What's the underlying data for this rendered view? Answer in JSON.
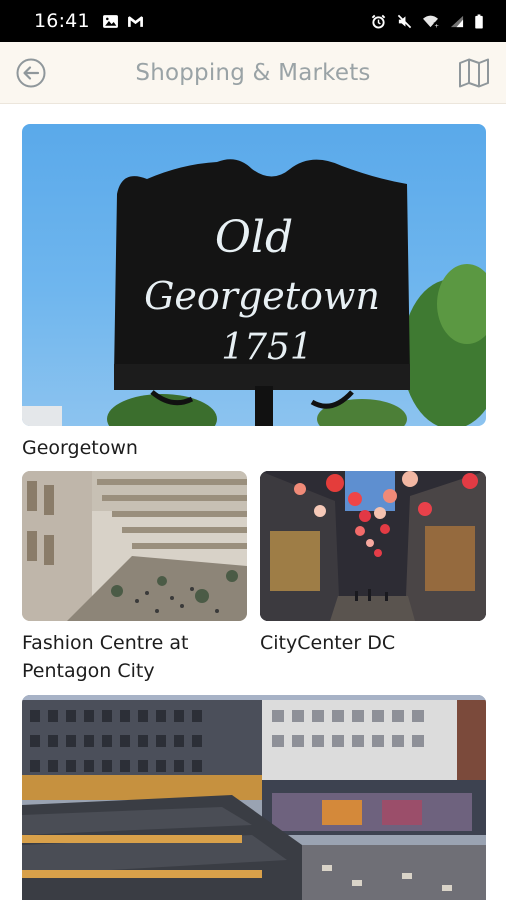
{
  "status_bar": {
    "time": "16:41",
    "left_icons": [
      "image-icon",
      "gmail-icon"
    ],
    "right_icons": [
      "alarm-icon",
      "mute-icon",
      "wifi-icon",
      "signal-icon",
      "battery-icon"
    ]
  },
  "header": {
    "title": "Shopping & Markets",
    "back_icon": "back-arrow-circle-icon",
    "map_icon": "map-icon"
  },
  "places": [
    {
      "name": "Georgetown",
      "sign": {
        "line1": "Old",
        "line2": "Georgetown",
        "line3": "1751"
      }
    },
    {
      "name": "Fashion Centre at Pentagon City"
    },
    {
      "name": "CityCenter DC"
    },
    {
      "name": ""
    }
  ],
  "colors": {
    "app_bar_bg": "#fbf7f0",
    "title_color": "#9aa3a6",
    "text_color": "#1d1d1d"
  }
}
